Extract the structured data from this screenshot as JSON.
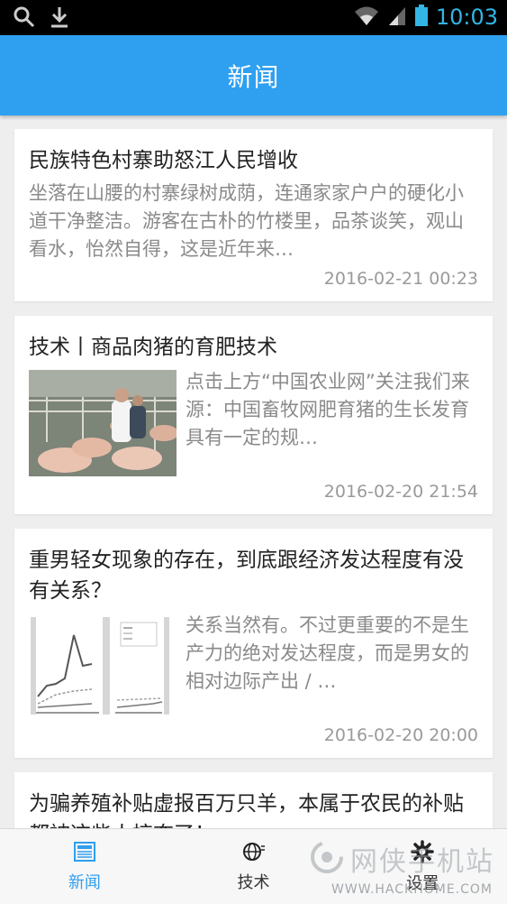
{
  "status_bar": {
    "time": "10:03",
    "icons": [
      "search-icon",
      "download-icon",
      "wifi-icon",
      "signal-icon",
      "battery-icon"
    ],
    "color": "#33b5e5"
  },
  "app_bar": {
    "title": "新闻",
    "color": "#2f9ff0"
  },
  "feed": {
    "items": [
      {
        "title": "民族特色村寨助怒江人民增收",
        "summary": "坐落在山腰的村寨绿树成荫，连通家家户户的硬化小道干净整洁。游客在古朴的竹楼里，品茶谈笑，观山看水，怡然自得，这是近年来…",
        "date": "2016-02-21 00:23"
      },
      {
        "title": "技术丨商品肉猪的育肥技术",
        "summary": "点击上方“中国农业网”关注我们来源：中国畜牧网肥育猪的生长发育具有一定的规…",
        "date": "2016-02-20 21:54",
        "thumbnail": "pig-farm-photo"
      },
      {
        "title": "重男轻女现象的存在，到底跟经济发达程度有没有关系？",
        "summary": "关系当然有。不过更重要的不是生产力的绝对发达程度，而是男女的相对边际产出 / …",
        "date": "2016-02-20 20:00",
        "thumbnail": "line-chart-figure"
      },
      {
        "title": "为骗养殖补贴虚报百万只羊，本属于农民的补贴都被这些人掠夺了！"
      }
    ]
  },
  "bottom_nav": {
    "items": [
      {
        "label": "新闻",
        "icon": "newspaper-icon",
        "active": true
      },
      {
        "label": "技术",
        "icon": "globe-icon",
        "active": false
      },
      {
        "label": "设置",
        "icon": "gear-icon",
        "active": false
      }
    ]
  },
  "watermark": {
    "text": "网侠手机站",
    "url": "WWW.HACKHOME.COM"
  }
}
